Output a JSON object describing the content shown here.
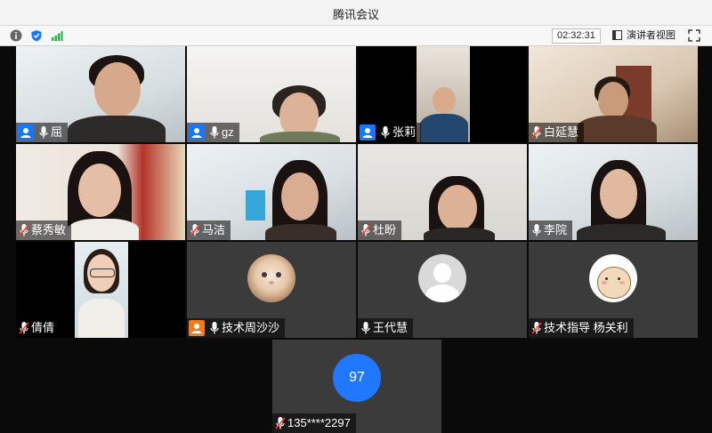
{
  "window": {
    "title": "腾讯会议"
  },
  "toolbar": {
    "timer": "02:32:31",
    "speaker_view_label": "演讲者视图",
    "icons": [
      "info-icon",
      "shield-icon",
      "signal-icon",
      "speaker-view-icon",
      "fullscreen-icon"
    ]
  },
  "participants": [
    {
      "name": "屈",
      "host": true,
      "mic": "on",
      "video": "camera"
    },
    {
      "name": "gz",
      "host": true,
      "mic": "on",
      "video": "camera"
    },
    {
      "name": "张莉",
      "host": true,
      "mic": "on",
      "video": "camera"
    },
    {
      "name": "白延慧",
      "host": false,
      "mic": "muted",
      "video": "camera"
    },
    {
      "name": "蔡秀敏",
      "host": false,
      "mic": "muted",
      "video": "camera"
    },
    {
      "name": "马洁",
      "host": false,
      "mic": "muted",
      "video": "camera"
    },
    {
      "name": "杜盼",
      "host": false,
      "mic": "muted",
      "video": "camera"
    },
    {
      "name": "李院",
      "host": false,
      "mic": "on",
      "video": "camera"
    },
    {
      "name": "倩倩",
      "host": false,
      "mic": "muted",
      "video": "camera"
    },
    {
      "name": "技术周沙沙",
      "host": true,
      "mic": "on",
      "video": "avatar-cat"
    },
    {
      "name": "王代慧",
      "host": false,
      "mic": "on",
      "video": "avatar-default"
    },
    {
      "name": "技术指导 杨关利",
      "host": false,
      "mic": "muted",
      "video": "avatar-sticker"
    },
    {
      "name": "135****2297",
      "host": false,
      "mic": "muted",
      "video": "avatar-number",
      "avatar_text": "97"
    }
  ],
  "colors": {
    "host_badge": "#1677ff",
    "host_badge_alt": "#f27b1f",
    "number_avatar": "#1f78ff"
  }
}
